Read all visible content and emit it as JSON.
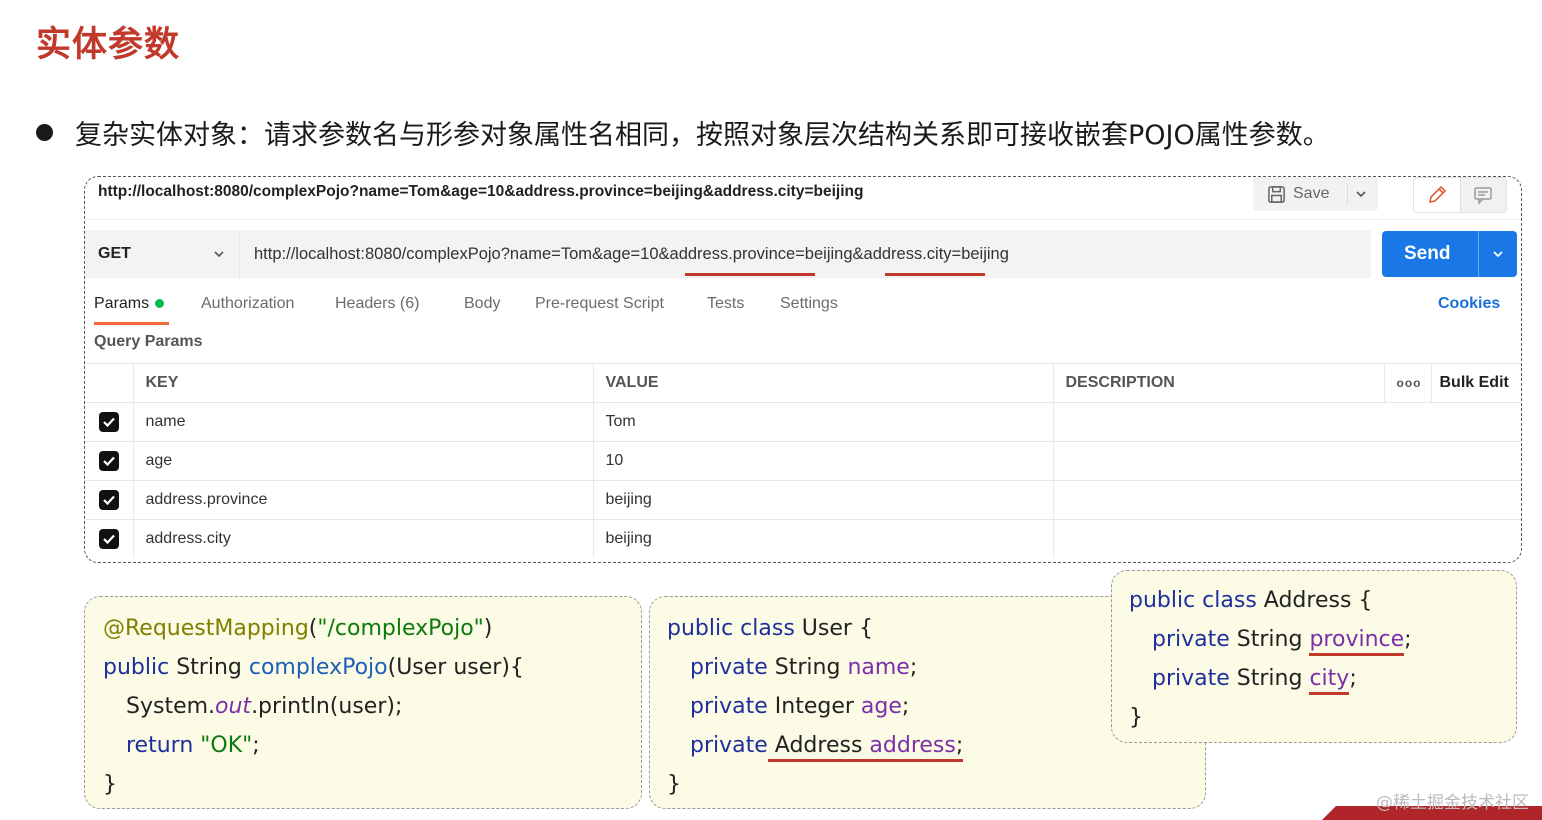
{
  "slide": {
    "title": "实体参数",
    "bullet": "复杂实体对象：请求参数名与形参对象属性名相同，按照对象层次结构关系即可接收嵌套POJO属性参数。"
  },
  "postman": {
    "request_name": "http://localhost:8080/complexPojo?name=Tom&age=10&address.province=beijing&address.city=beijing",
    "save_label": "Save",
    "method": "GET",
    "url": "http://localhost:8080/complexPojo?name=Tom&age=10&address.province=beijing&address.city=beijing",
    "send_label": "Send",
    "tabs": [
      {
        "label": "Params",
        "active": true
      },
      {
        "label": "Authorization"
      },
      {
        "label": "Headers (6)"
      },
      {
        "label": "Body"
      },
      {
        "label": "Pre-request Script"
      },
      {
        "label": "Tests"
      },
      {
        "label": "Settings"
      }
    ],
    "cookies_label": "Cookies",
    "query_params_label": "Query Params",
    "table": {
      "headers": [
        "KEY",
        "VALUE",
        "DESCRIPTION"
      ],
      "more_label": "ooo",
      "bulk_edit_label": "Bulk Edit",
      "rows": [
        {
          "key": "name",
          "value": "Tom",
          "checked": true
        },
        {
          "key": "age",
          "value": "10",
          "checked": true
        },
        {
          "key": "address.province",
          "value": "beijing",
          "checked": true
        },
        {
          "key": "address.city",
          "value": "beijing",
          "checked": true
        }
      ]
    },
    "colors": {
      "send": "#1a78e6",
      "tab_indicator": "#ef6a3a",
      "params_dot": "#0cbb52",
      "cookies": "#1a6fd8"
    }
  },
  "code": {
    "controller": {
      "annotation": "@RequestMapping",
      "paren_open": "(",
      "path": "\"/complexPojo\"",
      "paren_close": ")",
      "kw_public": "public",
      "ret_type": " String ",
      "method_name": "complexPojo",
      "params": "(User user){",
      "sys_prefix": "System.",
      "sys_out": "out",
      "sys_suffix": ".println(user);",
      "kw_return": "return",
      "ret_val": "\"OK\"",
      "semi": ";",
      "close": "}"
    },
    "user": {
      "decl_kw": "public class",
      "decl_name": " User {",
      "fields": [
        {
          "kw": "private",
          "type": " String ",
          "name": "name",
          "end": ";"
        },
        {
          "kw": "private",
          "type": " Integer ",
          "name": "age",
          "end": ";"
        },
        {
          "kw": "private",
          "type": " Address ",
          "name": "address",
          "end": ";"
        }
      ],
      "close": "}"
    },
    "address": {
      "decl_kw": "public class",
      "decl_name": " Address {",
      "fields": [
        {
          "kw": "private",
          "type": " String ",
          "name": "province",
          "end": ";"
        },
        {
          "kw": "private",
          "type": " String ",
          "name": "city",
          "end": ";"
        }
      ],
      "close": "}"
    }
  },
  "watermark": "@稀土掘金技术社区"
}
